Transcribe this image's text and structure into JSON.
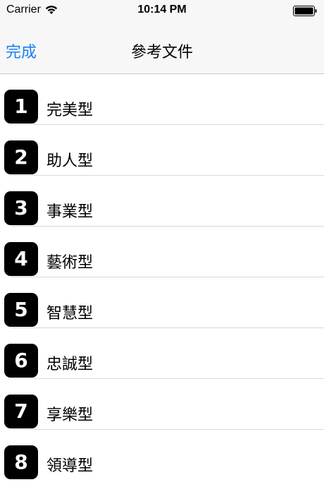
{
  "status_bar": {
    "carrier": "Carrier",
    "time": "10:14 PM",
    "wifi_icon": "wifi-icon",
    "battery_icon": "battery-icon"
  },
  "nav": {
    "done_label": "完成",
    "title": "參考文件"
  },
  "list": {
    "items": [
      {
        "number": "1",
        "label": "完美型"
      },
      {
        "number": "2",
        "label": "助人型"
      },
      {
        "number": "3",
        "label": "事業型"
      },
      {
        "number": "4",
        "label": "藝術型"
      },
      {
        "number": "5",
        "label": "智慧型"
      },
      {
        "number": "6",
        "label": "忠誠型"
      },
      {
        "number": "7",
        "label": "享樂型"
      },
      {
        "number": "8",
        "label": "領導型"
      }
    ]
  },
  "colors": {
    "accent": "#1a7ff5",
    "badge_bg": "#000000",
    "bar_bg": "#f7f7f7"
  }
}
